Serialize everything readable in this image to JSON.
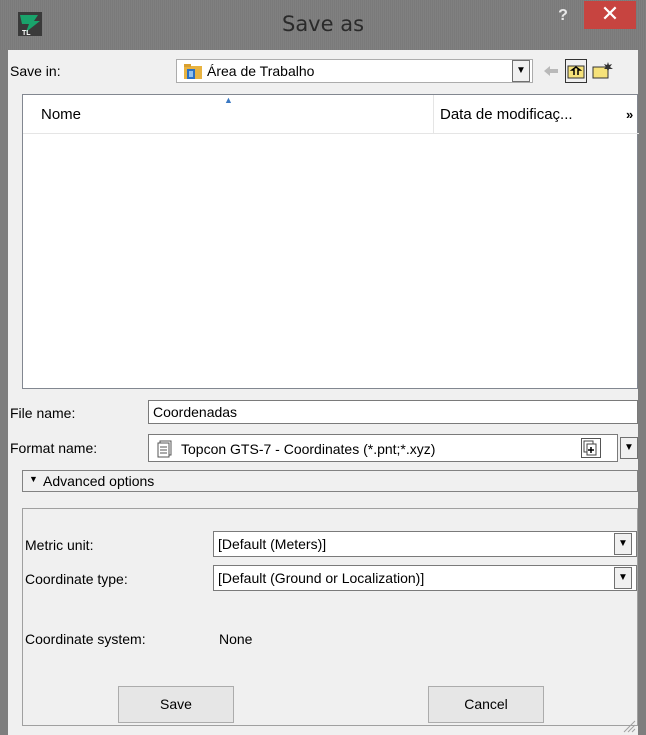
{
  "window": {
    "title": "Save as",
    "help_label": "?",
    "close_label": "✕",
    "app_icon": "tl-app-icon"
  },
  "save_in": {
    "label": "Save in:",
    "value": "Área de Trabalho",
    "icon": "folder-icon"
  },
  "toolbar": {
    "back_icon": "back-arrow-icon",
    "up_icon": "up-folder-icon",
    "new_folder_icon": "new-folder-icon"
  },
  "file_list": {
    "columns": [
      "Nome",
      "Data de modificaç...",
      "»"
    ]
  },
  "file_name": {
    "label": "File name:",
    "value": "Coordenadas"
  },
  "format_name": {
    "label": "Format name:",
    "value": "Topcon GTS-7 - Coordinates (*.pnt;*.xyz)"
  },
  "advanced": {
    "toggle_label": "Advanced options",
    "metric_unit_label": "Metric unit:",
    "metric_unit_value": "[Default (Meters)]",
    "coord_type_label": "Coordinate type:",
    "coord_type_value": "[Default (Ground or Localization)]",
    "coord_system_label": "Coordinate system:",
    "coord_system_value": "None"
  },
  "buttons": {
    "save": "Save",
    "cancel": "Cancel"
  },
  "colors": {
    "close_button": "#c74440",
    "titlebar": "#7e7e7e",
    "background": "#f0f0f0"
  }
}
